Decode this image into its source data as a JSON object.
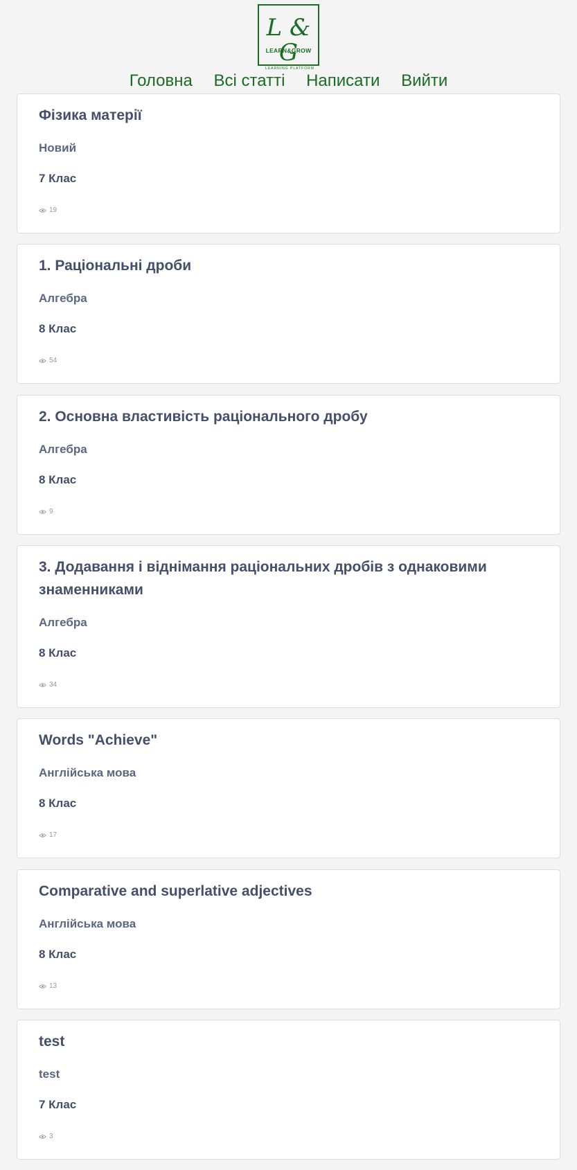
{
  "logo": {
    "mark": "L & G",
    "subtitle": "LEARN&GROW",
    "tagline": "LEARNING PLATFORM"
  },
  "nav": {
    "items": [
      "Головна",
      "Всі статті",
      "Написати",
      "Вийти"
    ]
  },
  "articles": [
    {
      "title": "Фізика матерії",
      "subject": "Новий",
      "grade": "7 Клас",
      "views": "19"
    },
    {
      "title": "1. Раціональні дроби",
      "subject": "Алгебра",
      "grade": "8 Клас",
      "views": "54"
    },
    {
      "title": "2. Основна властивість раціонального дробу",
      "subject": "Алгебра",
      "grade": "8 Клас",
      "views": "9"
    },
    {
      "title": "3. Додавання і віднімання раціональних дробів з однаковими знаменниками",
      "subject": "Алгебра",
      "grade": "8 Клас",
      "views": "34"
    },
    {
      "title": "Words \"Achieve\"",
      "subject": "Англійська мова",
      "grade": "8 Клас",
      "views": "17"
    },
    {
      "title": "Comparative and superlative adjectives",
      "subject": "Англійська мова",
      "grade": "8 Клас",
      "views": "13"
    },
    {
      "title": "test",
      "subject": "test",
      "grade": "7 Клас",
      "views": "3"
    }
  ]
}
